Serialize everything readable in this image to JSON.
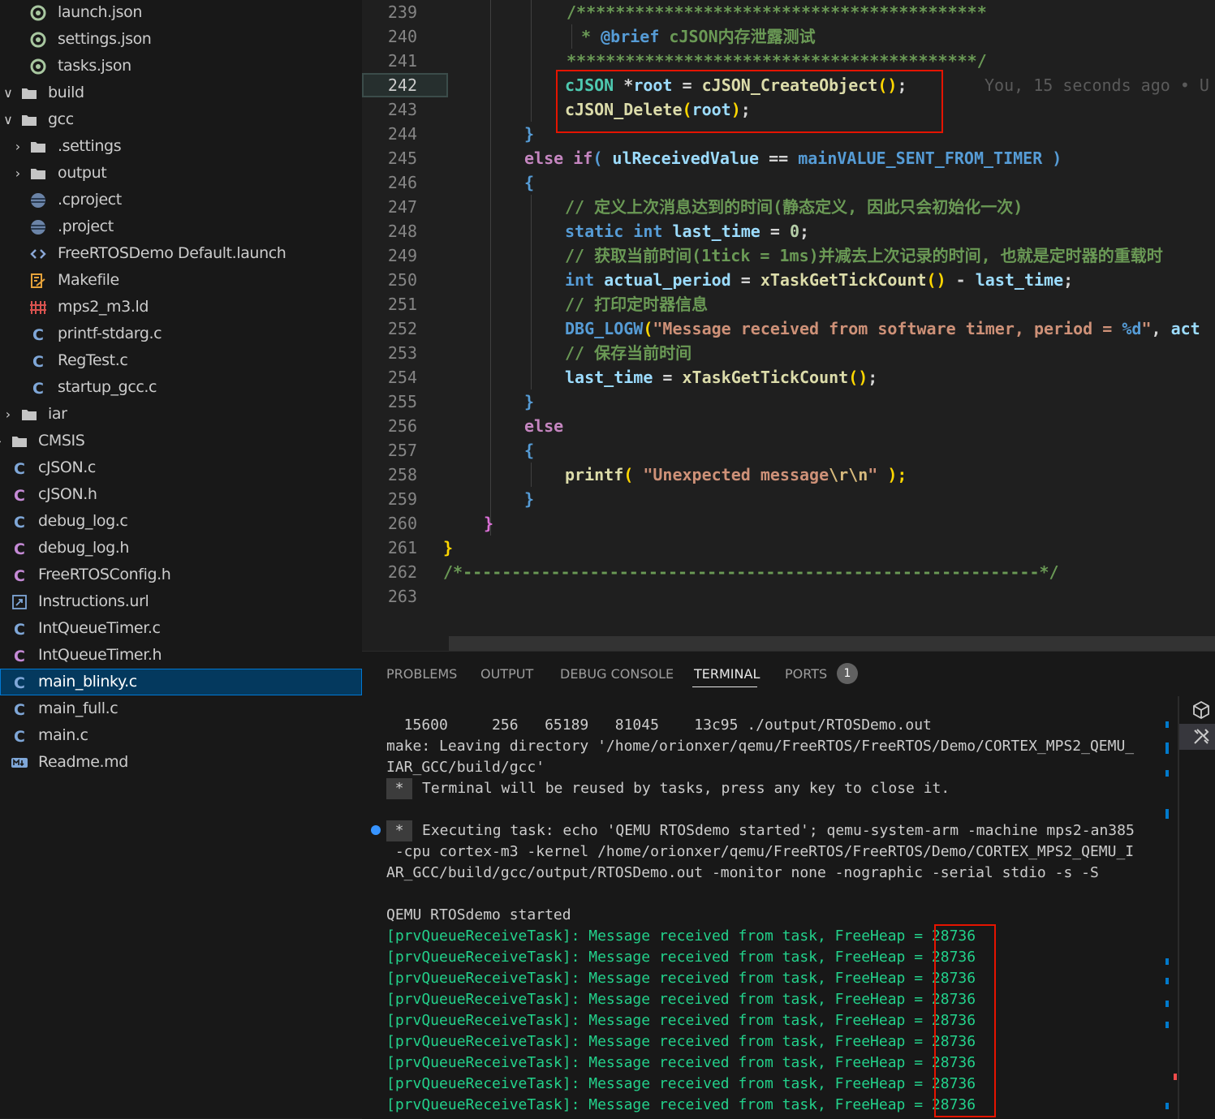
{
  "explorer": {
    "items": [
      {
        "name": "launch.json",
        "icon": "json-icon",
        "depth": 1,
        "chevron": "none"
      },
      {
        "name": "settings.json",
        "icon": "json-icon",
        "depth": 1,
        "chevron": "none"
      },
      {
        "name": "tasks.json",
        "icon": "json-icon",
        "depth": 1,
        "chevron": "none"
      },
      {
        "name": "build",
        "icon": "folder-icon",
        "depth": 0,
        "chevron": "expanded"
      },
      {
        "name": "gcc",
        "icon": "folder-icon",
        "depth": 0,
        "chevron": "expanded"
      },
      {
        "name": ".settings",
        "icon": "folder-icon",
        "depth": 1,
        "chevron": "collapsed"
      },
      {
        "name": "output",
        "icon": "folder-icon",
        "depth": 1,
        "chevron": "collapsed"
      },
      {
        "name": ".cproject",
        "icon": "project-icon",
        "depth": 1,
        "chevron": "none"
      },
      {
        "name": ".project",
        "icon": "project-icon",
        "depth": 1,
        "chevron": "none"
      },
      {
        "name": "FreeRTOSDemo Default.launch",
        "icon": "xml-icon",
        "depth": 1,
        "chevron": "none"
      },
      {
        "name": "Makefile",
        "icon": "makefile-icon",
        "depth": 1,
        "chevron": "none"
      },
      {
        "name": "mps2_m3.ld",
        "icon": "linker-icon",
        "depth": 1,
        "chevron": "none"
      },
      {
        "name": "printf-stdarg.c",
        "icon": "c-file-icon",
        "depth": 1,
        "chevron": "none"
      },
      {
        "name": "RegTest.c",
        "icon": "c-file-icon",
        "depth": 1,
        "chevron": "none"
      },
      {
        "name": "startup_gcc.c",
        "icon": "c-file-icon",
        "depth": 1,
        "chevron": "none"
      },
      {
        "name": "iar",
        "icon": "folder-icon",
        "depth": 0,
        "chevron": "collapsed"
      },
      {
        "name": "CMSIS",
        "icon": "folder-icon",
        "depth": -1,
        "chevron": "collapsed"
      },
      {
        "name": "cJSON.c",
        "icon": "c-file-icon",
        "depth": -1,
        "chevron": "none"
      },
      {
        "name": "cJSON.h",
        "icon": "h-file-icon",
        "depth": -1,
        "chevron": "none"
      },
      {
        "name": "debug_log.c",
        "icon": "c-file-icon",
        "depth": -1,
        "chevron": "none"
      },
      {
        "name": "debug_log.h",
        "icon": "h-file-icon",
        "depth": -1,
        "chevron": "none"
      },
      {
        "name": "FreeRTOSConfig.h",
        "icon": "h-file-icon",
        "depth": -1,
        "chevron": "none"
      },
      {
        "name": "Instructions.url",
        "icon": "url-icon",
        "depth": -1,
        "chevron": "none"
      },
      {
        "name": "IntQueueTimer.c",
        "icon": "c-file-icon",
        "depth": -1,
        "chevron": "none"
      },
      {
        "name": "IntQueueTimer.h",
        "icon": "h-file-icon",
        "depth": -1,
        "chevron": "none"
      },
      {
        "name": "main_blinky.c",
        "icon": "c-file-icon",
        "depth": -1,
        "chevron": "none",
        "selected": true
      },
      {
        "name": "main_full.c",
        "icon": "c-file-icon",
        "depth": -1,
        "chevron": "none"
      },
      {
        "name": "main.c",
        "icon": "c-file-icon",
        "depth": -1,
        "chevron": "none"
      },
      {
        "name": "Readme.md",
        "icon": "markdown-icon",
        "depth": -1,
        "chevron": "none"
      }
    ]
  },
  "editor": {
    "active_line": "242",
    "line_numbers": [
      "239",
      "240",
      "241",
      "242",
      "243",
      "244",
      "245",
      "246",
      "247",
      "248",
      "249",
      "250",
      "251",
      "252",
      "253",
      "254",
      "255",
      "256",
      "257",
      "258",
      "259",
      "260",
      "261",
      "262",
      "263"
    ],
    "lines": [
      [
        {
          "t": "/******************************************",
          "c": "comment"
        }
      ],
      [
        {
          "t": " * ",
          "c": "comment"
        },
        {
          "t": "@brief",
          "c": "kw"
        },
        {
          "t": " cJSON内存泄露测试",
          "c": "comment"
        }
      ],
      [
        {
          "t": "******************************************/",
          "c": "comment"
        }
      ],
      [
        {
          "t": "cJSON",
          "c": "type"
        },
        {
          "t": " *",
          "c": "plain"
        },
        {
          "t": "root",
          "c": "var"
        },
        {
          "t": " = ",
          "c": "plain"
        },
        {
          "t": "cJSON_CreateObject",
          "c": "fn"
        },
        {
          "t": "()",
          "c": "brace3"
        },
        {
          "t": ";",
          "c": "plain"
        }
      ],
      [
        {
          "t": "cJSON_Delete",
          "c": "fn"
        },
        {
          "t": "(",
          "c": "brace3"
        },
        {
          "t": "root",
          "c": "var"
        },
        {
          "t": ")",
          "c": "brace3"
        },
        {
          "t": ";",
          "c": "plain"
        }
      ],
      [
        {
          "t": "}",
          "c": "brace1"
        }
      ],
      [
        {
          "t": "else",
          "c": "ctl"
        },
        {
          "t": " ",
          "c": "plain"
        },
        {
          "t": "if",
          "c": "ctl"
        },
        {
          "t": "( ",
          "c": "brace1"
        },
        {
          "t": "ulReceivedValue",
          "c": "var"
        },
        {
          "t": " == ",
          "c": "plain"
        },
        {
          "t": "mainVALUE_SENT_FROM_TIMER",
          "c": "macro"
        },
        {
          "t": " )",
          "c": "brace1"
        }
      ],
      [
        {
          "t": "{",
          "c": "brace1"
        }
      ],
      [
        {
          "t": "// 定义上次消息达到的时间(静态定义, 因此只会初始化一次)",
          "c": "comment"
        }
      ],
      [
        {
          "t": "static",
          "c": "kw"
        },
        {
          "t": " ",
          "c": "plain"
        },
        {
          "t": "int",
          "c": "kw"
        },
        {
          "t": " ",
          "c": "plain"
        },
        {
          "t": "last_time",
          "c": "var"
        },
        {
          "t": " = ",
          "c": "plain"
        },
        {
          "t": "0",
          "c": "num"
        },
        {
          "t": ";",
          "c": "plain"
        }
      ],
      [
        {
          "t": "// 获取当前时间(1tick = 1ms)并减去上次记录的时间, 也就是定时器的重载时",
          "c": "comment"
        }
      ],
      [
        {
          "t": "int",
          "c": "kw"
        },
        {
          "t": " ",
          "c": "plain"
        },
        {
          "t": "actual_period",
          "c": "var"
        },
        {
          "t": " = ",
          "c": "plain"
        },
        {
          "t": "xTaskGetTickCount",
          "c": "fn"
        },
        {
          "t": "()",
          "c": "brace3"
        },
        {
          "t": " - ",
          "c": "plain"
        },
        {
          "t": "last_time",
          "c": "var"
        },
        {
          "t": ";",
          "c": "plain"
        }
      ],
      [
        {
          "t": "// 打印定时器信息",
          "c": "comment"
        }
      ],
      [
        {
          "t": "DBG_LOGW",
          "c": "macro"
        },
        {
          "t": "(",
          "c": "brace3"
        },
        {
          "t": "\"Message received from software timer, period = ",
          "c": "str"
        },
        {
          "t": "%d",
          "c": "kw"
        },
        {
          "t": "\"",
          "c": "str"
        },
        {
          "t": ", ",
          "c": "plain"
        },
        {
          "t": "act",
          "c": "var"
        }
      ],
      [
        {
          "t": "// 保存当前时间",
          "c": "comment"
        }
      ],
      [
        {
          "t": "last_time",
          "c": "var"
        },
        {
          "t": " = ",
          "c": "plain"
        },
        {
          "t": "xTaskGetTickCount",
          "c": "fn"
        },
        {
          "t": "()",
          "c": "brace3"
        },
        {
          "t": ";",
          "c": "plain"
        }
      ],
      [
        {
          "t": "}",
          "c": "brace1"
        }
      ],
      [
        {
          "t": "else",
          "c": "ctl"
        }
      ],
      [
        {
          "t": "{",
          "c": "brace1"
        }
      ],
      [
        {
          "t": "printf",
          "c": "fn"
        },
        {
          "t": "( ",
          "c": "brace3"
        },
        {
          "t": "\"Unexpected message",
          "c": "str"
        },
        {
          "t": "\\r\\n",
          "c": "esc"
        },
        {
          "t": "\"",
          "c": "str"
        },
        {
          "t": " );",
          "c": "brace3"
        }
      ],
      [
        {
          "t": "}",
          "c": "brace1"
        }
      ],
      [
        {
          "t": "}",
          "c": "brace2"
        }
      ],
      [
        {
          "t": "}",
          "c": "brace3"
        }
      ],
      [
        {
          "t": "/*-----------------------------------------------------------*/",
          "c": "comment"
        }
      ],
      []
    ],
    "blame": "You, 15 seconds ago • U"
  },
  "panel": {
    "tabs": [
      "PROBLEMS",
      "OUTPUT",
      "DEBUG CONSOLE",
      "TERMINAL",
      "PORTS"
    ],
    "active_tab": "TERMINAL",
    "ports_count": "1",
    "terminal": {
      "size_line": "  15600     256   65189   81045    13c95 ./output/RTOSDemo.out",
      "make_line1": "make: Leaving directory '/home/orionxer/qemu/FreeRTOS/FreeRTOS/Demo/CORTEX_MPS2_QEMU_",
      "make_line2": "IAR_GCC/build/gcc'",
      "star": "*",
      "reuse_msg": "Terminal will be reused by tasks, press any key to close it.",
      "exec_line1": "Executing task: echo 'QEMU RTOSdemo started'; qemu-system-arm -machine mps2-an385",
      "exec_line2": " -cpu cortex-m3 -kernel /home/orionxer/qemu/FreeRTOS/FreeRTOS/Demo/CORTEX_MPS2_QEMU_I",
      "exec_line3": "AR_GCC/build/gcc/output/RTOSDemo.out -monitor none -nographic -serial stdio -s -S",
      "started": "QEMU RTOSdemo started",
      "messages": [
        {
          "text": "[prvQueueReceiveTask]: Message received from task, FreeHeap = ",
          "heap": "28736"
        },
        {
          "text": "[prvQueueReceiveTask]: Message received from task, FreeHeap = ",
          "heap": "28736"
        },
        {
          "text": "[prvQueueReceiveTask]: Message received from task, FreeHeap = ",
          "heap": "28736"
        },
        {
          "text": "[prvQueueReceiveTask]: Message received from task, FreeHeap = ",
          "heap": "28736"
        },
        {
          "text": "[prvQueueReceiveTask]: Message received from task, FreeHeap = ",
          "heap": "28736"
        },
        {
          "text": "[prvQueueReceiveTask]: Message received from task, FreeHeap = ",
          "heap": "28736"
        },
        {
          "text": "[prvQueueReceiveTask]: Message received from task, FreeHeap = ",
          "heap": "28736"
        },
        {
          "text": "[prvQueueReceiveTask]: Message received from task, FreeHeap = ",
          "heap": "28736"
        },
        {
          "text": "[prvQueueReceiveTask]: Message received from task, FreeHeap = ",
          "heap": "28736"
        }
      ]
    }
  },
  "colors": {
    "accent": "#0078d4",
    "highlight_box": "#e51400",
    "terminal_green": "#23d18b"
  }
}
